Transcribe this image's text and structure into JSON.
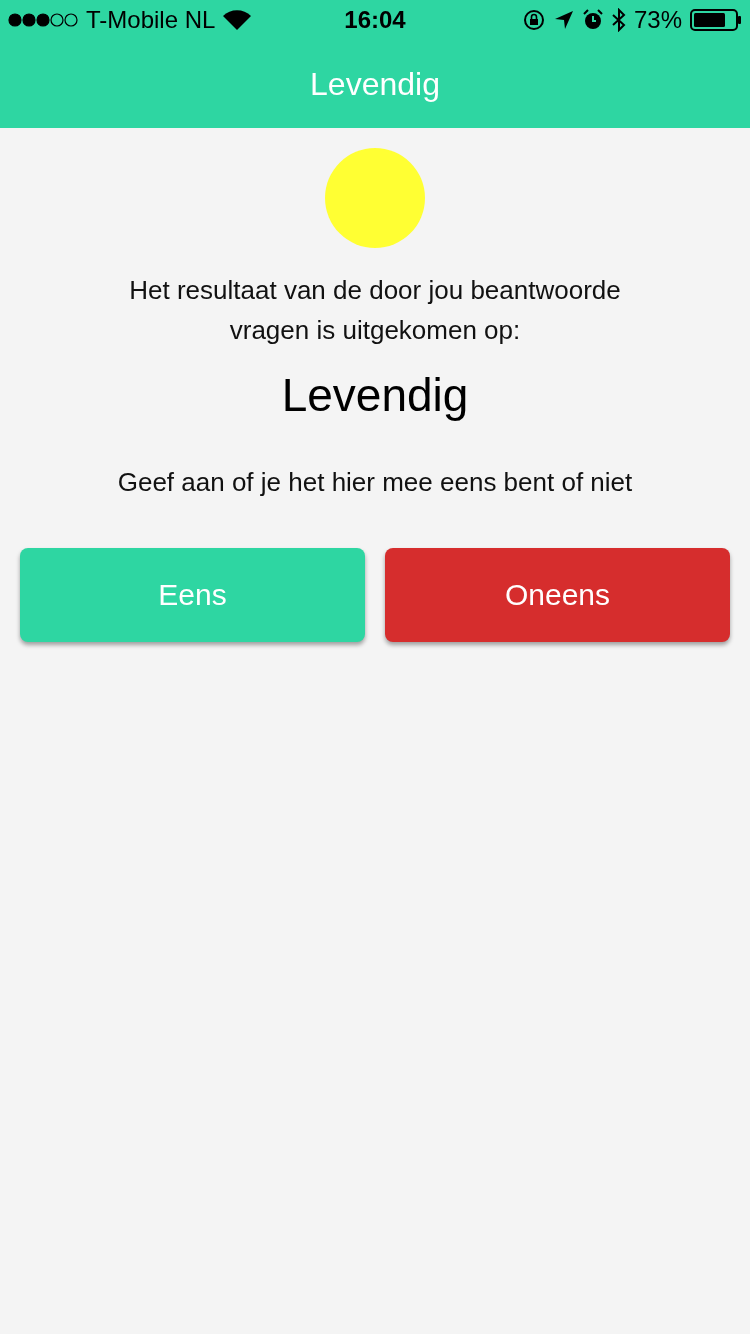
{
  "status_bar": {
    "carrier": "T-Mobile NL",
    "time": "16:04",
    "battery": "73%"
  },
  "nav_bar": {
    "title": "Levendig"
  },
  "result": {
    "intro": "Het resultaat van de door jou beantwoorde vragen is uitgekomen op:",
    "value": "Levendig",
    "question": "Geef aan of je het hier mee eens bent of niet"
  },
  "buttons": [
    {
      "label": "Eens",
      "kind": "agree"
    },
    {
      "label": "Oneens",
      "kind": "disagree"
    }
  ]
}
